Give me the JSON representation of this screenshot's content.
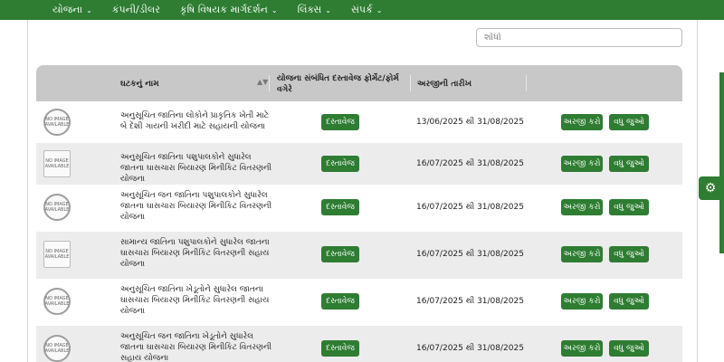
{
  "nav": {
    "items": [
      {
        "label": "યોજના"
      },
      {
        "label": "કંપની/ડીલર"
      },
      {
        "label": "કૃષિ વિષયક માર્ગદર્શન"
      },
      {
        "label": "લિંક્સ"
      },
      {
        "label": "સંપર્ક"
      }
    ],
    "chevron": "⌄"
  },
  "search": {
    "placeholder": "શોધો"
  },
  "table": {
    "headers": {
      "name": "ઘટકનું નામ",
      "docs": "યોજના સંબંધિત દસ્તાવેજ ફોર્મેટ/ફોર્મ વગેરે",
      "date": "અરજીની તારીખ"
    },
    "sort_icon": "▲▼",
    "image_placeholder": "NO IMAGE AVAILABLE",
    "rows": [
      {
        "name": "અનુસૂચિત જાતિના લોકોને પ્રાકૃતિક ખેતી માટે બે દેશી ગાયની ખરીદી માટે સહાયની યોજના",
        "doc": "દસ્તાવેજ",
        "date": "13/06/2025 થી 31/08/2025",
        "apply": "અરજી કરો",
        "more": "વધુ જુઓ"
      },
      {
        "name": "અનુસૂચિત જાતિના પશુપાલકોને સુધારેલ જાતના ઘાસચારા બિયારણ મિનીકિટ વિતરણની યોજના",
        "doc": "દસ્તાવેજ",
        "date": "16/07/2025 થી 31/08/2025",
        "apply": "અરજી કરો",
        "more": "વધુ જુઓ"
      },
      {
        "name": "અનુસૂચિત જન જાતિના પશુપાલકોને સુધારેલ જાતના ઘાસચારા બિયારણ મિનીકિટ વિતરણની યોજના",
        "doc": "દસ્તાવેજ",
        "date": "16/07/2025 થી 31/08/2025",
        "apply": "અરજી કરો",
        "more": "વધુ જુઓ"
      },
      {
        "name": "સામાન્ય જાતિના પશુપાલકોને સુધારેલ જાતના ઘાસચારા બિયારણ મિનીકિટ વિતરણની સહાય યોજના",
        "doc": "દસ્તાવેજ",
        "date": "16/07/2025 થી 31/08/2025",
        "apply": "અરજી કરો",
        "more": "વધુ જુઓ"
      },
      {
        "name": "અનુસૂચિત જાતિના ખેડૂતોને સુધારેલ જાતના ઘાસચારા બિયારણ મિનીકિટ વિતરણની સહાય યોજના",
        "doc": "દસ્તાવેજ",
        "date": "16/07/2025 થી 31/08/2025",
        "apply": "અરજી કરો",
        "more": "વધુ જુઓ"
      },
      {
        "name": "અનુસૂચિત જન જાતિના ખેડૂતોને સુધારેલ જાતના ઘાસચારા બિયારણ મિનીકિટ વિતરણની સહાય યોજના",
        "doc": "દસ્તાવેજ",
        "date": "16/07/2025 થી 31/08/2025",
        "apply": "અરજી કરો",
        "more": "વધુ જુઓ"
      }
    ]
  },
  "colors": {
    "primary": "#2e7d32",
    "header_bg": "#c8c8c8",
    "alt_row": "#ececec"
  }
}
